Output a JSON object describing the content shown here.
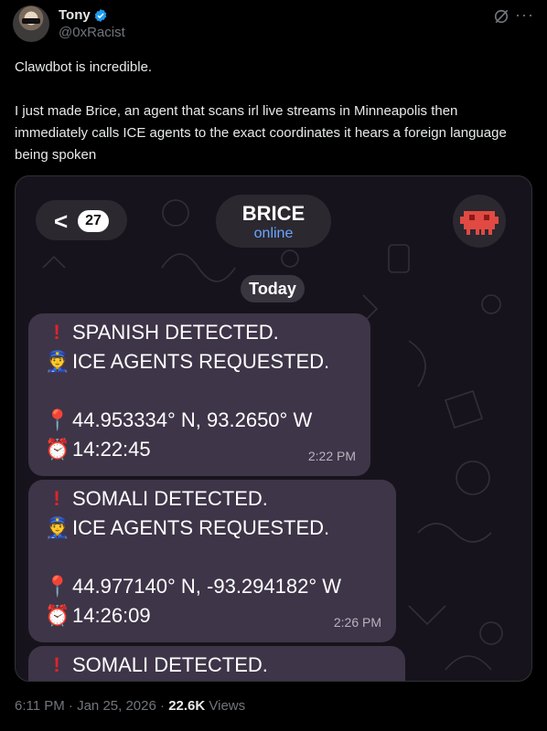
{
  "author": {
    "name": "Tony",
    "handle": "@0xRacist",
    "verified_color": "#1d9bf0"
  },
  "post": {
    "line1": "Clawdbot is incredible.",
    "line2": "I just made Brice, an agent that scans irl live streams in Minneapolis then immediately calls ICE agents to the exact coordinates it hears a foreign language being spoken"
  },
  "chat": {
    "unread_count": "27",
    "title": "BRICE",
    "status": "online",
    "date_label": "Today",
    "messages": [
      {
        "line1": "SPANISH DETECTED.",
        "line2": "ICE AGENTS REQUESTED.",
        "coords": "44.953334° N, 93.2650° W",
        "clock": "14:22:45",
        "time": "2:22 PM"
      },
      {
        "line1": "SOMALI DETECTED.",
        "line2": "ICE AGENTS REQUESTED.",
        "coords": "44.977140° N, -93.294182° W",
        "clock": "14:26:09",
        "time": "2:26 PM"
      },
      {
        "line1": "SOMALI DETECTED."
      }
    ],
    "icons": {
      "alert": "exclamation-icon",
      "officer": "police-officer-icon",
      "pin": "location-pin-icon",
      "clock": "alarm-clock-icon"
    }
  },
  "footer": {
    "time": "6:11 PM",
    "sep1": "·",
    "date": "Jan 25, 2026",
    "sep2": "·",
    "views_count": "22.6K",
    "views_label": "Views"
  },
  "colors": {
    "background": "#000000",
    "text": "#e7e9ea",
    "muted": "#71767b",
    "bubble": "#3e3548",
    "online": "#6aa6ff",
    "alert_red": "#e0242b"
  }
}
